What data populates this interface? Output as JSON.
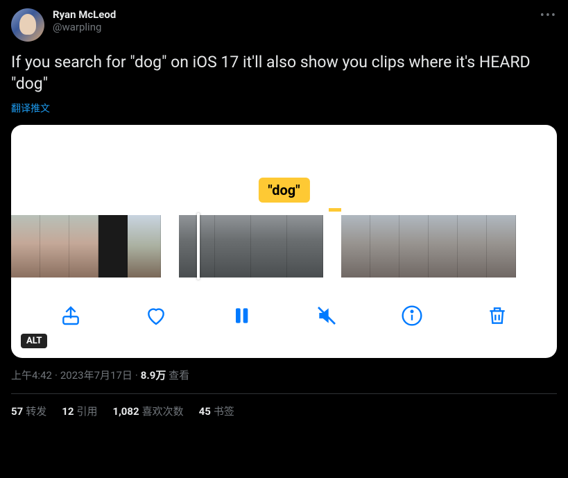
{
  "author": {
    "display_name": "Ryan McLeod",
    "handle": "@warpling"
  },
  "body_text": "If you search for \"dog\" on iOS 17 it'll also show you clips where it's HEARD \"dog\"",
  "translate_label": "翻译推文",
  "media": {
    "tag_label": "\"dog\"",
    "alt_badge": "ALT"
  },
  "meta": {
    "time": "上午4:42",
    "date": "2023年7月17日",
    "views_value": "8.9万",
    "views_label": "查看"
  },
  "stats": {
    "retweets": {
      "value": "57",
      "label": "转发"
    },
    "quotes": {
      "value": "12",
      "label": "引用"
    },
    "likes": {
      "value": "1,082",
      "label": "喜欢次数"
    },
    "bookmarks": {
      "value": "45",
      "label": "书签"
    }
  }
}
